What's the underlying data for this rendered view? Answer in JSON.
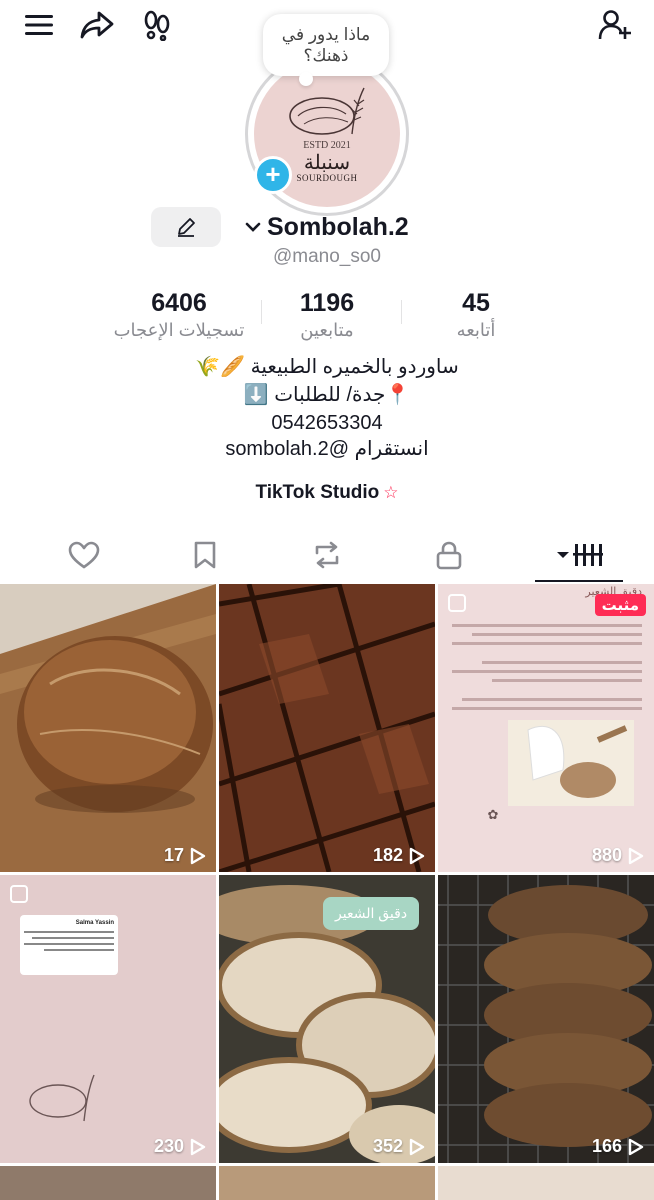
{
  "top_bar": {
    "menu_icon": "hamburger-menu-icon",
    "share_icon": "share-arrow-icon",
    "feet_icon": "footprints-icon",
    "add_friend_icon": "add-user-icon"
  },
  "profile": {
    "thought_bubble": "ماذا يدور في ذهنك؟",
    "avatar": {
      "estd": "ESTD 2021",
      "brand": "سنبلة",
      "sub": "SOURDOUGH"
    },
    "display_name": "Sombolah.2",
    "username": "@mano_so0"
  },
  "stats": [
    {
      "value": "6406",
      "label": "تسجيلات الإعجاب"
    },
    {
      "value": "1196",
      "label": "متابعين"
    },
    {
      "value": "45",
      "label": "أتابعه"
    }
  ],
  "bio": {
    "line1": "ساوردو بالخميره الطبيعية 🥖🌾",
    "line2": "📍جدة/ للطلبات ⬇️",
    "line3": "0542653304",
    "line4": "انستقرام @sombolah.2"
  },
  "studio": {
    "label": "TikTok Studio"
  },
  "tabs": [
    "videos",
    "private",
    "reposts",
    "favorites",
    "liked"
  ],
  "posts": [
    {
      "views": "17",
      "kind": "bread-loaf"
    },
    {
      "views": "182",
      "kind": "brownies"
    },
    {
      "views": "880",
      "kind": "info-doc",
      "pinned": "مثبت",
      "heading": "دقيق الشعير"
    },
    {
      "views": "230",
      "kind": "comment-reply",
      "commenter": "Salma Yassin"
    },
    {
      "views": "352",
      "kind": "sliced-bread",
      "caption": "دقيق الشعير"
    },
    {
      "views": "166",
      "kind": "rye-slices"
    }
  ],
  "colors": {
    "accent": "#fe2c55",
    "avatar_bg": "#ecd3d1",
    "add_badge": "#2fb5e8",
    "caption_bubble": "#a8d6c4"
  }
}
